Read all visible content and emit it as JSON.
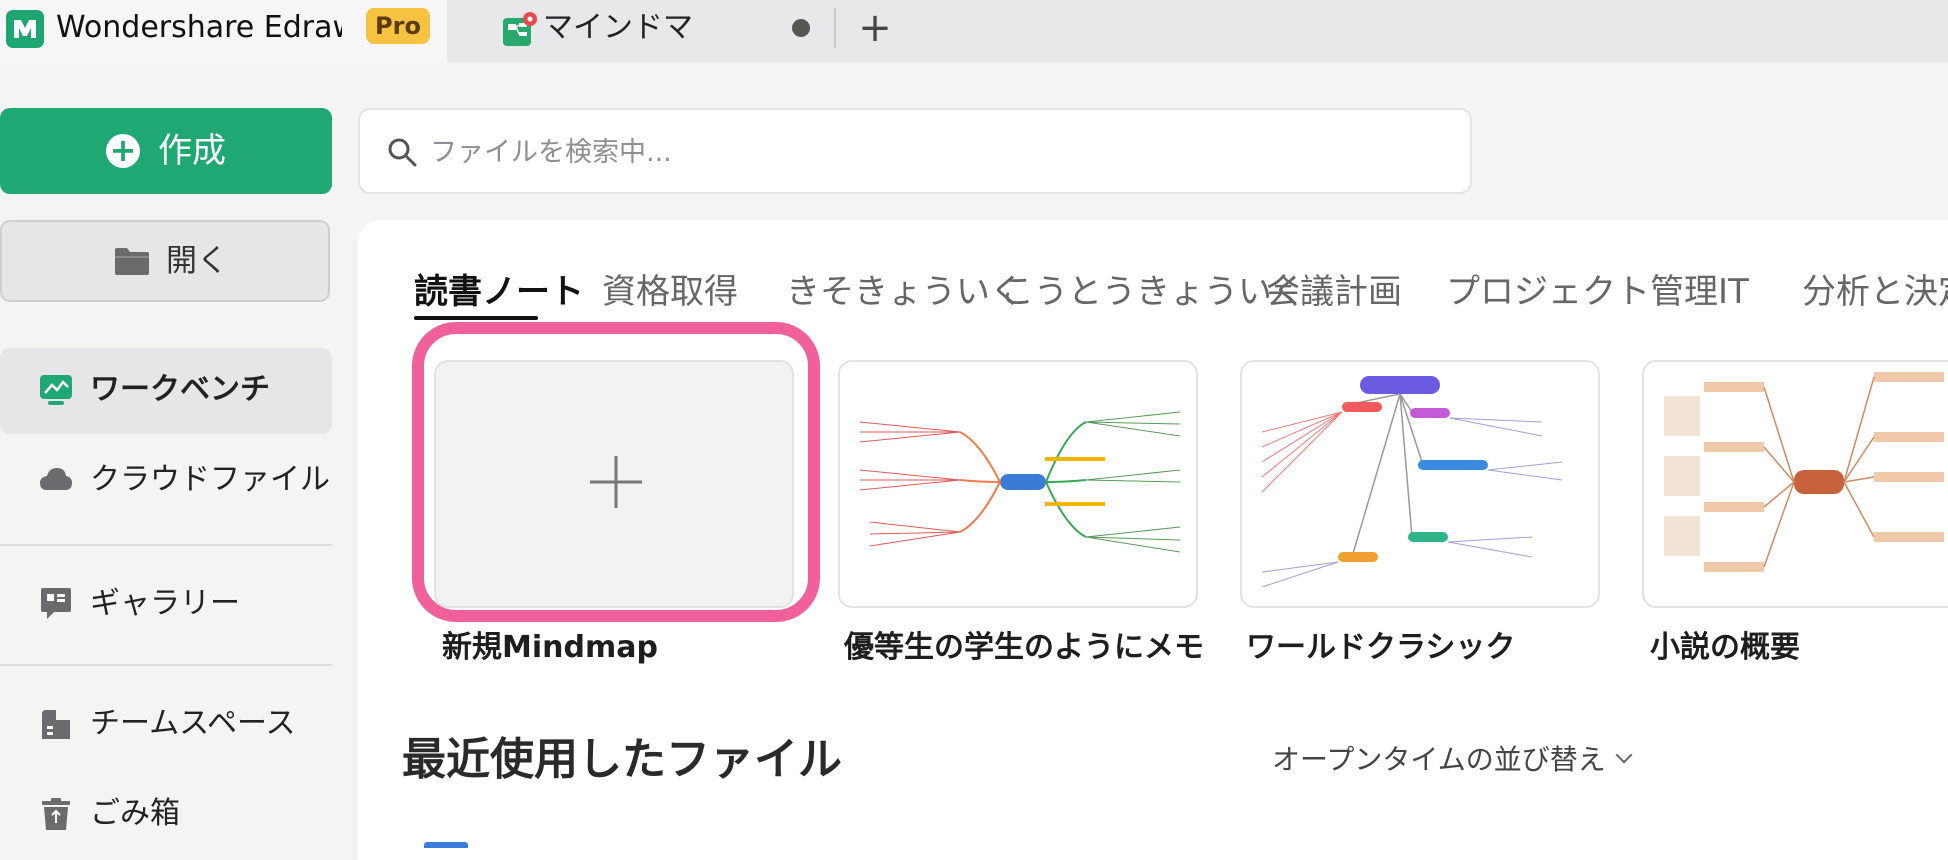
{
  "titlebar": {
    "app_title": "Wondershare EdrawMind",
    "pro_badge": "Pro",
    "doc_tab_title": "マインドマップ",
    "new_tab_symbol": "+"
  },
  "sidebar": {
    "create_label": "作成",
    "open_label": "開く",
    "items": [
      {
        "label": "ワークベンチ",
        "icon": "workbench-icon"
      },
      {
        "label": "クラウドファイル",
        "icon": "cloud-icon"
      },
      {
        "label": "ギャラリー",
        "icon": "gallery-icon"
      },
      {
        "label": "チームスペース",
        "icon": "team-space-icon"
      },
      {
        "label": "ごみ箱",
        "icon": "trash-icon"
      }
    ]
  },
  "search": {
    "placeholder": "ファイルを検索中..."
  },
  "categories": [
    "読書ノート",
    "資格取得",
    "きそきょういく",
    "こうとうきょういく",
    "会議計画",
    "プロジェクト管理",
    "IT",
    "分析と決定"
  ],
  "active_category": "読書ノート",
  "templates": [
    {
      "label": "新規Mindmap"
    },
    {
      "label": "優等生の学生のようにメモを..."
    },
    {
      "label": "ワールドクラシック"
    },
    {
      "label": "小説の概要"
    }
  ],
  "recent": {
    "title": "最近使用したファイル",
    "sort_label": "オープンタイムの並び替え"
  },
  "colors": {
    "accent": "#1fa874",
    "highlight": "#f0609a",
    "pro": "#f6c341"
  }
}
